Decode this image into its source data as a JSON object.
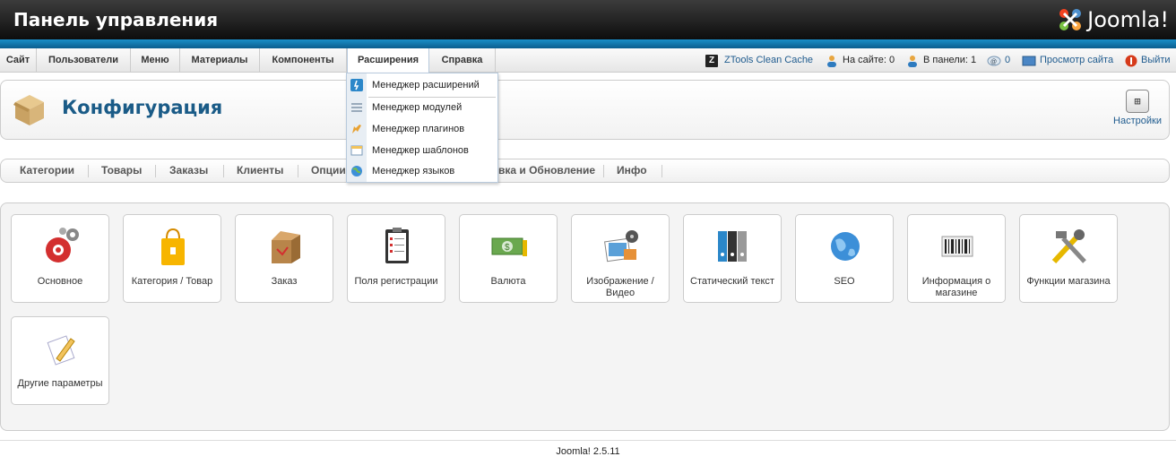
{
  "header": {
    "title": "Панель управления",
    "logo_text": "Joomla!"
  },
  "menu": {
    "items": [
      {
        "label": "Сайт"
      },
      {
        "label": "Пользователи"
      },
      {
        "label": "Меню"
      },
      {
        "label": "Материалы"
      },
      {
        "label": "Компоненты"
      },
      {
        "label": "Расширения"
      },
      {
        "label": "Справка"
      }
    ],
    "active": "Расширения"
  },
  "status": {
    "clean_cache": "ZTools Clean Cache",
    "on_site": "На сайте: 0",
    "in_panel": "В панели: 1",
    "messages": "0",
    "view_site": "Просмотр сайта",
    "logout": "Выйти"
  },
  "dropdown": {
    "items": [
      {
        "label": "Менеджер расширений",
        "icon": "extension-manager-icon"
      },
      {
        "label": "Менеджер модулей",
        "icon": "module-manager-icon"
      },
      {
        "label": "Менеджер плагинов",
        "icon": "plugin-manager-icon"
      },
      {
        "label": "Менеджер шаблонов",
        "icon": "template-manager-icon"
      },
      {
        "label": "Менеджер языков",
        "icon": "language-manager-icon"
      }
    ]
  },
  "toolbar": {
    "title": "Конфигурация",
    "settings_label": "Настройки"
  },
  "subnav": {
    "items": [
      {
        "label": "Категории"
      },
      {
        "label": "Товары"
      },
      {
        "label": "Заказы"
      },
      {
        "label": "Клиенты"
      },
      {
        "label": "Опции"
      },
      {
        "label": "вка и Обновление"
      },
      {
        "label": "Инфо"
      }
    ]
  },
  "tiles": [
    {
      "label": "Основное",
      "icon": "gears-icon"
    },
    {
      "label": "Категория / Товар",
      "icon": "shopping-bag-icon"
    },
    {
      "label": "Заказ",
      "icon": "box-icon"
    },
    {
      "label": "Поля регистрации",
      "icon": "clipboard-icon"
    },
    {
      "label": "Валюта",
      "icon": "money-icon"
    },
    {
      "label": "Изображение / Видео",
      "icon": "media-icon"
    },
    {
      "label": "Статический текст",
      "icon": "binders-icon"
    },
    {
      "label": "SEO",
      "icon": "globe-icon"
    },
    {
      "label": "Информация о магазине",
      "icon": "barcode-icon"
    },
    {
      "label": "Функции магазина",
      "icon": "tools-icon"
    },
    {
      "label": "Другие параметры",
      "icon": "edit-icon"
    }
  ],
  "footer": {
    "version": "Joomla! 2.5.11"
  },
  "colors": {
    "accent": "#1a5b87",
    "header_bg": "#1a1a1a",
    "bar_blue": "#1a8fc9"
  }
}
